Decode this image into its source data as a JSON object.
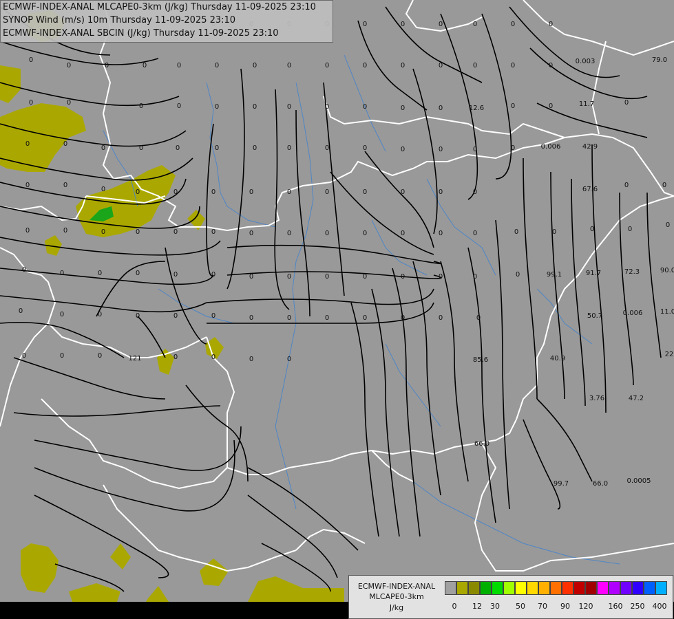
{
  "header": {
    "line1": "ECMWF-INDEX-ANAL MLCAPE0-3km (J/kg) Thursday 11-09-2025 23:10",
    "line2": "SYNOP Wind (m/s) 10m Thursday 11-09-2025 23:10",
    "line3": "ECMWF-INDEX-ANAL SBCIN (J/kg) Thursday 11-09-2025 23:10"
  },
  "legend": {
    "line1": "ECMWF-INDEX-ANAL",
    "line2": "MLCAPE0-3km",
    "unit": "J/kg",
    "colors": [
      "#a0a0a0",
      "#a8a800",
      "#8a8a00",
      "#00b000",
      "#00dc00",
      "#a0ff00",
      "#ffff00",
      "#ffd800",
      "#ffb000",
      "#ff7000",
      "#ff3000",
      "#c00000",
      "#a00000",
      "#ff00ff",
      "#b000ff",
      "#7000ff",
      "#3000ff",
      "#0060ff",
      "#00b0ff",
      "#00e8ff",
      "#a0ffff",
      "#ffffff"
    ],
    "ticks": [
      "0",
      "12",
      "30",
      "50",
      "70",
      "90",
      "120",
      "160",
      "250",
      "400"
    ]
  },
  "map_colors": {
    "background": "#999999",
    "cape_low": "#aaa800",
    "cape_mid": "#1aa51a",
    "border": "#ffffff",
    "river": "#4f86c6",
    "streamline": "#000000"
  },
  "cin_labels": [
    "0",
    "0",
    "0",
    "0",
    "0",
    "0",
    "0",
    "0",
    "0",
    "0",
    "0",
    "0",
    "0",
    "0",
    "0",
    "0",
    "0",
    "0",
    "0",
    "0",
    "0",
    "0",
    "0",
    "0",
    "0",
    "0",
    "0",
    "0",
    "0",
    "0",
    "0",
    "0",
    "0",
    "0",
    "0",
    "0",
    "0",
    "0",
    "0",
    "0",
    "0",
    "0",
    "0",
    "0",
    "0",
    "0",
    "0",
    "0",
    "0",
    "0",
    "0",
    "0",
    "0",
    "0",
    "0",
    "0",
    "0",
    "0",
    "0",
    "0",
    "0",
    "0",
    "0",
    "0",
    "0",
    "0",
    "0",
    "0",
    "0",
    "0",
    "0",
    "0",
    "0",
    "0",
    "0",
    "0",
    "0",
    "0",
    "0",
    "0",
    "0",
    "0",
    "0",
    "0",
    "0",
    "0",
    "0",
    "0",
    "0",
    "0",
    "0",
    "0",
    "0",
    "0",
    "0",
    "0",
    "0",
    "0",
    "0",
    "0",
    "0",
    "0",
    "0",
    "0",
    "0",
    "0",
    "0",
    "0",
    "0",
    "0",
    "0",
    "0",
    "0",
    "0",
    "0",
    "0",
    "0",
    "0",
    "0",
    "0",
    "0.003",
    "79.0",
    "12.6",
    "11.7",
    "0.006",
    "42.9",
    "67.6",
    "99.1",
    "91.7",
    "72.3",
    "90.0",
    "50.7",
    "0.006",
    "11.0",
    "121",
    "85.6",
    "40.9",
    "22",
    "3.76",
    "47.2",
    "66.0",
    "99.7",
    "66.0",
    "0.0005"
  ]
}
